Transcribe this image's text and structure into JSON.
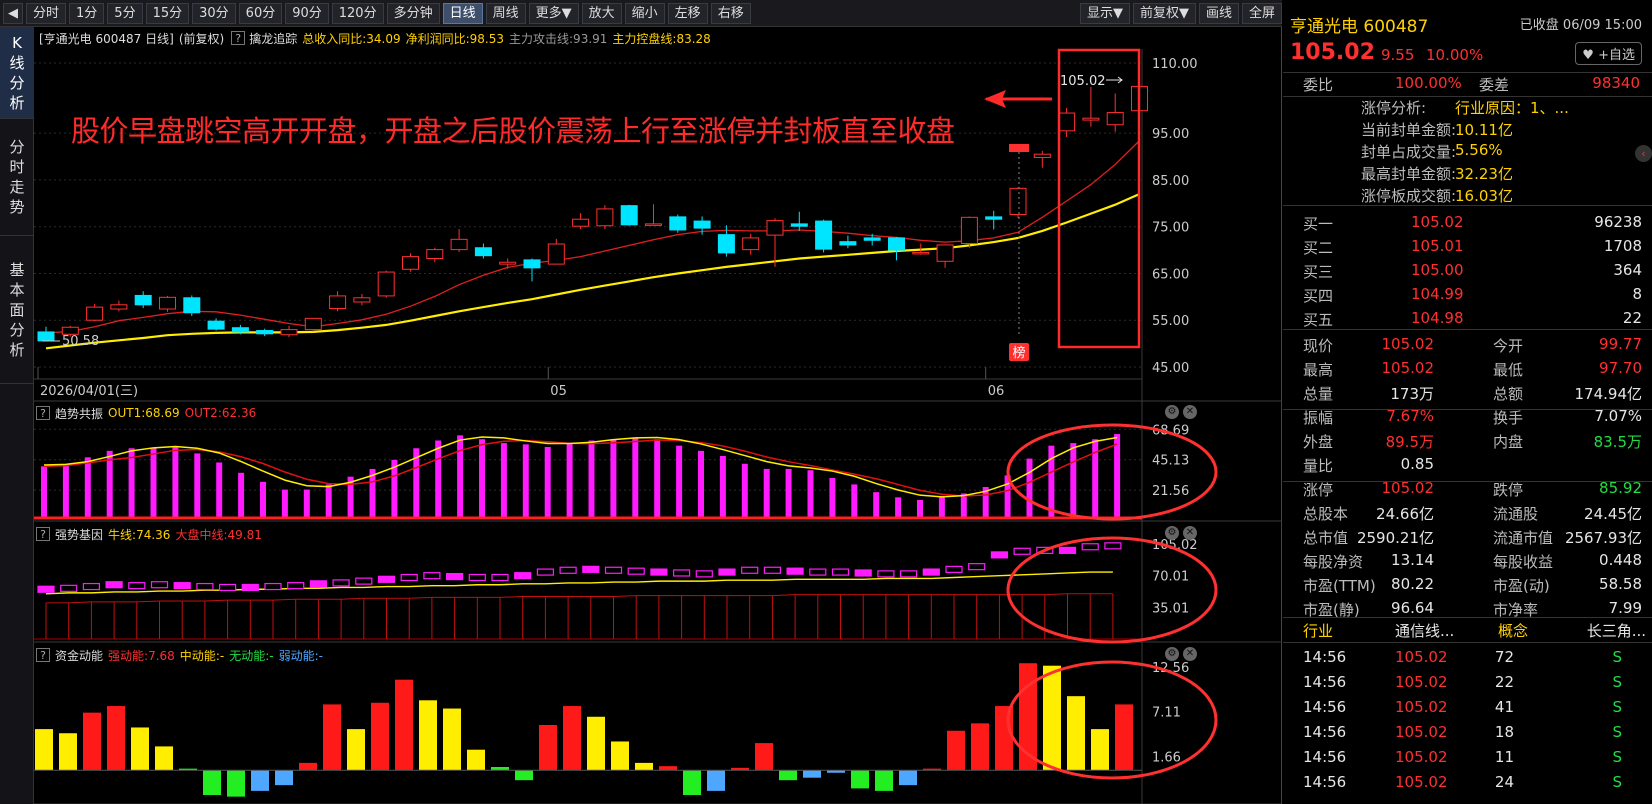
{
  "toolbar": {
    "collapse": "◀",
    "periods": [
      "分时",
      "1分",
      "5分",
      "15分",
      "30分",
      "60分",
      "90分",
      "120分",
      "多分钟",
      "日线",
      "周线",
      "更多▼",
      "放大",
      "缩小",
      "左移",
      "右移"
    ],
    "active_period": "日线",
    "right": [
      "显示▼",
      "前复权▼",
      "画线",
      "全屏"
    ]
  },
  "left_nav": [
    {
      "label": "K线分析",
      "active": true
    },
    {
      "label": "分时走势",
      "active": false
    },
    {
      "label": "基本面分析",
      "active": false
    }
  ],
  "info_bar": {
    "stock": "[亨通光电 600487 日线]",
    "adjust": "(前复权)",
    "indicator": "擒龙追踪",
    "rev": "总收入同比:34.09",
    "profit": "净利润同比:98.53",
    "attack": "主力攻击线:93.91",
    "control": "主力控盘线:83.28"
  },
  "annotation": "股价早盘跳空高开开盘，开盘之后股价震荡上行至涨停并封板直至收盘",
  "chart_data": [
    {
      "type": "candlestick",
      "title": "亨通光电 600487 日线",
      "y_ticks": [
        "110.00",
        "95.00",
        "85.00",
        "75.00",
        "65.00",
        "55.00",
        "45.00"
      ],
      "ylim": [
        45,
        110
      ],
      "x_labels": [
        {
          "index": 0,
          "label": "2026/04/01(三)"
        },
        {
          "index": 21,
          "label": "05"
        },
        {
          "index": 39,
          "label": "06"
        }
      ],
      "candles": [
        {
          "o": 52.5,
          "h": 53.6,
          "l": 50.6,
          "c": 50.6
        },
        {
          "o": 52.0,
          "h": 53.8,
          "l": 51.5,
          "c": 53.5
        },
        {
          "o": 55.0,
          "h": 58.5,
          "l": 54.8,
          "c": 57.8
        },
        {
          "o": 57.4,
          "h": 59.2,
          "l": 56.9,
          "c": 58.3
        },
        {
          "o": 60.3,
          "h": 61.2,
          "l": 57.6,
          "c": 58.3
        },
        {
          "o": 57.4,
          "h": 60.2,
          "l": 56.8,
          "c": 59.9
        },
        {
          "o": 59.8,
          "h": 60.3,
          "l": 55.9,
          "c": 56.6
        },
        {
          "o": 54.8,
          "h": 55.4,
          "l": 52.8,
          "c": 53.1
        },
        {
          "o": 53.4,
          "h": 54.0,
          "l": 52.0,
          "c": 52.5
        },
        {
          "o": 52.8,
          "h": 53.2,
          "l": 51.6,
          "c": 52.1
        },
        {
          "o": 51.9,
          "h": 53.8,
          "l": 51.4,
          "c": 53.0
        },
        {
          "o": 53.0,
          "h": 55.5,
          "l": 52.6,
          "c": 55.4
        },
        {
          "o": 57.5,
          "h": 61.2,
          "l": 56.9,
          "c": 60.2
        },
        {
          "o": 58.9,
          "h": 60.6,
          "l": 58.2,
          "c": 59.8
        },
        {
          "o": 60.2,
          "h": 65.6,
          "l": 59.8,
          "c": 65.3
        },
        {
          "o": 65.9,
          "h": 69.3,
          "l": 65.4,
          "c": 68.6
        },
        {
          "o": 68.2,
          "h": 70.5,
          "l": 67.4,
          "c": 70.1
        },
        {
          "o": 70.1,
          "h": 74.5,
          "l": 69.6,
          "c": 72.3
        },
        {
          "o": 70.5,
          "h": 71.4,
          "l": 68.2,
          "c": 68.8
        },
        {
          "o": 67.0,
          "h": 68.2,
          "l": 66.0,
          "c": 67.4
        },
        {
          "o": 67.9,
          "h": 68.2,
          "l": 63.3,
          "c": 66.2
        },
        {
          "o": 67.0,
          "h": 72.4,
          "l": 67.0,
          "c": 71.3
        },
        {
          "o": 75.1,
          "h": 77.9,
          "l": 74.5,
          "c": 76.6
        },
        {
          "o": 75.2,
          "h": 79.6,
          "l": 74.5,
          "c": 78.8
        },
        {
          "o": 79.5,
          "h": 79.7,
          "l": 75.2,
          "c": 75.4
        },
        {
          "o": 75.6,
          "h": 79.8,
          "l": 75.2,
          "c": 75.6
        },
        {
          "o": 77.1,
          "h": 77.6,
          "l": 73.7,
          "c": 74.3
        },
        {
          "o": 76.2,
          "h": 77.2,
          "l": 73.3,
          "c": 74.7
        },
        {
          "o": 73.3,
          "h": 75.3,
          "l": 68.6,
          "c": 69.4
        },
        {
          "o": 70.1,
          "h": 73.5,
          "l": 69.0,
          "c": 72.6
        },
        {
          "o": 73.2,
          "h": 76.8,
          "l": 66.4,
          "c": 76.3
        },
        {
          "o": 75.6,
          "h": 78.2,
          "l": 74.1,
          "c": 75.1
        },
        {
          "o": 76.2,
          "h": 76.5,
          "l": 69.5,
          "c": 70.2
        },
        {
          "o": 71.8,
          "h": 73.1,
          "l": 70.4,
          "c": 71.1
        },
        {
          "o": 72.6,
          "h": 73.5,
          "l": 71.0,
          "c": 72.1
        },
        {
          "o": 72.6,
          "h": 72.8,
          "l": 67.8,
          "c": 70.0
        },
        {
          "o": 69.5,
          "h": 71.4,
          "l": 69.0,
          "c": 69.5
        },
        {
          "o": 67.6,
          "h": 71.2,
          "l": 66.2,
          "c": 71.1
        },
        {
          "o": 71.4,
          "h": 77.2,
          "l": 70.5,
          "c": 77.0
        },
        {
          "o": 77.1,
          "h": 78.4,
          "l": 74.4,
          "c": 76.6
        },
        {
          "o": 77.6,
          "h": 83.4,
          "l": 76.9,
          "c": 83.2
        },
        {
          "o": 89.8,
          "h": 91.2,
          "l": 87.6,
          "c": 90.5
        },
        {
          "o": 95.5,
          "h": 100.4,
          "l": 94.2,
          "c": 99.3
        },
        {
          "o": 97.8,
          "h": 104.9,
          "l": 96.4,
          "c": 98.2
        },
        {
          "o": 96.8,
          "h": 103.5,
          "l": 95.3,
          "c": 99.4
        },
        {
          "o": 99.8,
          "h": 105.0,
          "l": 97.7,
          "c": 105.0
        }
      ],
      "ma_red": [
        52.3,
        52.6,
        53.6,
        54.9,
        55.6,
        56.4,
        56.9,
        56.8,
        56.1,
        55.2,
        54.3,
        53.6,
        54.3,
        55.1,
        56.3,
        58.0,
        60.1,
        62.6,
        64.6,
        66.3,
        67.2,
        67.8,
        68.6,
        69.8,
        71.0,
        72.2,
        73.3,
        74.0,
        74.2,
        74.1,
        74.1,
        74.3,
        74.0,
        73.6,
        73.1,
        72.7,
        72.1,
        71.7,
        72.0,
        72.6,
        73.8,
        77.0,
        80.5,
        84.0,
        88.3,
        93.4
      ],
      "ma_yellow": [
        49.0,
        49.6,
        50.2,
        50.7,
        51.2,
        51.8,
        52.1,
        52.3,
        52.4,
        52.4,
        52.4,
        52.5,
        52.9,
        53.4,
        54.0,
        54.9,
        55.9,
        56.9,
        57.8,
        58.7,
        59.5,
        60.5,
        61.5,
        62.4,
        63.3,
        64.2,
        65.0,
        65.7,
        66.4,
        67.0,
        67.6,
        68.2,
        68.6,
        69.0,
        69.4,
        69.8,
        70.1,
        70.4,
        71.0,
        71.7,
        72.6,
        74.1,
        75.9,
        77.8,
        79.7,
        82.0
      ],
      "price_labels": {
        "low": "50.58",
        "high": "105.02"
      }
    },
    {
      "type": "bar",
      "title": "趋势共振",
      "series": [
        {
          "name": "OUT1",
          "value_label": "68.69"
        },
        {
          "name": "OUT2",
          "value_label": "62.36"
        }
      ],
      "y_ticks": [
        "68.69",
        "45.13",
        "21.56"
      ],
      "ylim": [
        0,
        72
      ],
      "values": [
        40,
        41,
        47,
        52,
        54,
        54,
        55,
        50,
        43,
        35,
        28,
        22,
        22,
        26,
        32,
        38,
        45,
        54,
        60,
        64,
        61,
        58,
        57,
        55,
        58,
        60,
        61,
        62,
        61,
        56,
        52,
        48,
        42,
        38,
        38,
        37,
        31,
        26,
        20,
        16,
        14,
        16,
        19,
        24,
        33,
        46,
        56,
        58,
        61,
        65
      ]
    },
    {
      "type": "bar",
      "title": "强势基因",
      "series": [
        {
          "name": "牛线",
          "value_label": "74.36"
        },
        {
          "name": "大盘中线",
          "value_label": "49.81"
        }
      ],
      "y_ticks": [
        "105.02",
        "70.01",
        "35.01"
      ],
      "ylim": [
        0,
        115
      ],
      "boxes": [
        55,
        56,
        58,
        60,
        59,
        60,
        59,
        58,
        57,
        57,
        58,
        59,
        61,
        62,
        64,
        66,
        68,
        70,
        69,
        68,
        68,
        70,
        74,
        76,
        77,
        76,
        75,
        74,
        73,
        72,
        74,
        76,
        76,
        75,
        74,
        74,
        73,
        72,
        72,
        74,
        77,
        80,
        93,
        97,
        98,
        98,
        102,
        103
      ],
      "yellow_line": [
        50,
        51,
        51,
        52,
        52,
        53,
        53,
        54,
        54,
        55,
        55,
        56,
        56,
        57,
        57,
        58,
        58,
        59,
        59,
        60,
        60,
        61,
        61,
        62,
        62,
        63,
        63,
        64,
        64,
        64,
        65,
        65,
        65,
        66,
        66,
        66,
        66,
        67,
        67,
        67,
        68,
        69,
        70,
        71,
        72,
        73,
        74,
        74
      ],
      "red_bars": [
        40,
        40,
        41,
        41,
        41,
        42,
        42,
        42,
        43,
        43,
        43,
        44,
        44,
        44,
        45,
        45,
        45,
        46,
        46,
        46,
        46,
        47,
        47,
        47,
        47,
        47,
        48,
        48,
        48,
        48,
        48,
        48,
        48,
        49,
        49,
        49,
        49,
        49,
        49,
        49,
        49,
        49,
        49,
        49,
        49,
        50,
        50,
        50
      ]
    },
    {
      "type": "bar",
      "title": "资金动能",
      "series": [
        {
          "name": "强动能",
          "value_label": "7.68"
        },
        {
          "name": "中动能",
          "value_label": "-"
        },
        {
          "name": "无动能",
          "value_label": "-"
        },
        {
          "name": "弱动能",
          "value_label": "-"
        }
      ],
      "y_ticks": [
        "12.56",
        "7.11",
        "1.66"
      ],
      "ylim": [
        -3,
        14
      ],
      "values": [
        {
          "v": 5,
          "c": "yellow"
        },
        {
          "v": 4.5,
          "c": "yellow"
        },
        {
          "v": 7,
          "c": "red"
        },
        {
          "v": 7.8,
          "c": "red"
        },
        {
          "v": 5.2,
          "c": "yellow"
        },
        {
          "v": 2.9,
          "c": "yellow"
        },
        {
          "v": 0.2,
          "c": "green"
        },
        {
          "v": -3.0,
          "c": "green"
        },
        {
          "v": -3.2,
          "c": "green"
        },
        {
          "v": -2.5,
          "c": "blue"
        },
        {
          "v": -1.8,
          "c": "blue"
        },
        {
          "v": 0.9,
          "c": "red"
        },
        {
          "v": 8.0,
          "c": "red"
        },
        {
          "v": 5.0,
          "c": "yellow"
        },
        {
          "v": 8.2,
          "c": "red"
        },
        {
          "v": 11.0,
          "c": "red"
        },
        {
          "v": 8.5,
          "c": "yellow"
        },
        {
          "v": 7.5,
          "c": "yellow"
        },
        {
          "v": 2.5,
          "c": "yellow"
        },
        {
          "v": 0.4,
          "c": "green"
        },
        {
          "v": -1.2,
          "c": "green"
        },
        {
          "v": 5.5,
          "c": "red"
        },
        {
          "v": 7.8,
          "c": "red"
        },
        {
          "v": 6.5,
          "c": "yellow"
        },
        {
          "v": 3.5,
          "c": "yellow"
        },
        {
          "v": 0.9,
          "c": "yellow"
        },
        {
          "v": 0.5,
          "c": "red"
        },
        {
          "v": -3.0,
          "c": "green"
        },
        {
          "v": -2.5,
          "c": "blue"
        },
        {
          "v": 0.3,
          "c": "red"
        },
        {
          "v": 3.3,
          "c": "red"
        },
        {
          "v": -1.2,
          "c": "green"
        },
        {
          "v": -0.9,
          "c": "blue"
        },
        {
          "v": -0.3,
          "c": "blue"
        },
        {
          "v": -2.2,
          "c": "green"
        },
        {
          "v": -2.5,
          "c": "green"
        },
        {
          "v": -1.8,
          "c": "blue"
        },
        {
          "v": 0.2,
          "c": "red"
        },
        {
          "v": 4.8,
          "c": "red"
        },
        {
          "v": 5.7,
          "c": "red"
        },
        {
          "v": 7.8,
          "c": "red"
        },
        {
          "v": 13.0,
          "c": "red"
        },
        {
          "v": 12.7,
          "c": "yellow"
        },
        {
          "v": 9.0,
          "c": "yellow"
        },
        {
          "v": 5.0,
          "c": "yellow"
        },
        {
          "v": 8.0,
          "c": "red"
        }
      ]
    }
  ],
  "marker_bang": "榜",
  "right_panel": {
    "name": "亨通光电 600487",
    "status": "已收盘 06/09 15:00",
    "price": "105.02",
    "change": "9.55",
    "pct": "10.00%",
    "watch": "+自选",
    "weibi_label": "委比",
    "weibi": "100.00%",
    "weicha_label": "委差",
    "weicha": "98340",
    "limit_analysis": [
      {
        "label": "涨停分析:",
        "value": "行业原因：1、..."
      },
      {
        "label": "当前封单金额:",
        "value": "10.11亿"
      },
      {
        "label": "封单占成交量:",
        "value": "5.56%"
      },
      {
        "label": "最高封单金额:",
        "value": "32.23亿"
      },
      {
        "label": "涨停板成交额:",
        "value": "16.03亿"
      }
    ],
    "bids": [
      {
        "label": "买一",
        "price": "105.02",
        "vol": "96238"
      },
      {
        "label": "买二",
        "price": "105.01",
        "vol": "1708"
      },
      {
        "label": "买三",
        "price": "105.00",
        "vol": "364"
      },
      {
        "label": "买四",
        "price": "104.99",
        "vol": "8"
      },
      {
        "label": "买五",
        "price": "104.98",
        "vol": "22"
      }
    ],
    "stats": [
      {
        "l1": "现价",
        "v1": "105.02",
        "c1": "red",
        "l2": "今开",
        "v2": "99.77",
        "c2": "red"
      },
      {
        "l1": "最高",
        "v1": "105.02",
        "c1": "red",
        "l2": "最低",
        "v2": "97.70",
        "c2": "red"
      },
      {
        "l1": "总量",
        "v1": "173万",
        "c1": "white",
        "l2": "总额",
        "v2": "174.94亿",
        "c2": "white"
      },
      {
        "l1": "振幅",
        "v1": "7.67%",
        "c1": "red",
        "l2": "换手",
        "v2": "7.07%",
        "c2": "white"
      },
      {
        "l1": "外盘",
        "v1": "89.5万",
        "c1": "red",
        "l2": "内盘",
        "v2": "83.5万",
        "c2": "green"
      },
      {
        "l1": "量比",
        "v1": "0.85",
        "c1": "white",
        "l2": "",
        "v2": "",
        "c2": "white"
      },
      {
        "l1": "涨停",
        "v1": "105.02",
        "c1": "red",
        "l2": "跌停",
        "v2": "85.92",
        "c2": "green"
      },
      {
        "l1": "总股本",
        "v1": "24.66亿",
        "c1": "white",
        "l2": "流通股",
        "v2": "24.45亿",
        "c2": "white"
      },
      {
        "l1": "总市值",
        "v1": "2590.21亿",
        "c1": "white",
        "l2": "流通市值",
        "v2": "2567.93亿",
        "c2": "white"
      },
      {
        "l1": "每股净资",
        "v1": "13.14",
        "c1": "white",
        "l2": "每股收益",
        "v2": "0.448",
        "c2": "white"
      },
      {
        "l1": "市盈(TTM)",
        "v1": "80.22",
        "c1": "white",
        "l2": "市盈(动)",
        "v2": "58.58",
        "c2": "white"
      },
      {
        "l1": "市盈(静)",
        "v1": "96.64",
        "c1": "white",
        "l2": "市净率",
        "v2": "7.99",
        "c2": "white"
      }
    ],
    "industry_label": "行业",
    "industry": "通信线...",
    "concept_label": "概念",
    "concept": "长三角...",
    "ticks": [
      {
        "time": "14:56",
        "price": "105.02",
        "vol": "72",
        "side": "S"
      },
      {
        "time": "14:56",
        "price": "105.02",
        "vol": "22",
        "side": "S"
      },
      {
        "time": "14:56",
        "price": "105.02",
        "vol": "41",
        "side": "S"
      },
      {
        "time": "14:56",
        "price": "105.02",
        "vol": "18",
        "side": "S"
      },
      {
        "time": "14:56",
        "price": "105.02",
        "vol": "11",
        "side": "S"
      },
      {
        "time": "14:56",
        "price": "105.02",
        "vol": "24",
        "side": "S"
      }
    ]
  }
}
